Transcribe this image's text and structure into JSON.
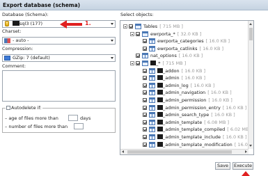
{
  "window": {
    "title": "Export database (schema)"
  },
  "left": {
    "database_label": "Database (Schema):",
    "database_value": "sql3 (177)",
    "charset_label": "Charset:",
    "charset_value": "- auto -",
    "compression_label": "Compression:",
    "compression_value": "GZip: 7 (default)",
    "comment_label": "Comment:",
    "autodelete": {
      "legend": "Autodelete if:",
      "age_label": "– age of files more than",
      "age_unit": "days",
      "number_label": "– number of files more than",
      "age_value": "",
      "number_value": ""
    }
  },
  "annotations": {
    "step1": "1.",
    "colors": {
      "annotation": "#e02020"
    }
  },
  "tree": {
    "label": "Select objects:",
    "rows": [
      {
        "name": "Tables",
        "size": "[ 715 MB ]",
        "icon": "folder-icon",
        "level": 0,
        "redacted": false
      },
      {
        "name": "ewrporta_*",
        "size": "[ 32.0 KB ]",
        "icon": "table-group-icon",
        "level": 1,
        "redacted": false
      },
      {
        "name": "ewrporta_categories",
        "size": "[ 16.0 KB ]",
        "icon": "table-icon",
        "level": 2,
        "redacted": false
      },
      {
        "name": "ewrporta_catlinks",
        "size": "[ 16.0 KB ]",
        "icon": "table-icon",
        "level": 2,
        "redacted": false
      },
      {
        "name": "nat_options",
        "size": "[ 16.0 KB ]",
        "icon": "table-icon",
        "level": 1,
        "redacted": false
      },
      {
        "name": "_*",
        "size": "[ 715 MB ]",
        "icon": "table-group-icon",
        "level": 1,
        "redacted": true
      },
      {
        "name": "_addon",
        "size": "[ 16.0 KB ]",
        "icon": "table-icon",
        "level": 2,
        "redacted": true
      },
      {
        "name": "_admin",
        "size": "[ 16.0 KB ]",
        "icon": "table-icon",
        "level": 2,
        "redacted": true
      },
      {
        "name": "_admin_log",
        "size": "[ 16.0 KB ]",
        "icon": "table-icon",
        "level": 2,
        "redacted": true
      },
      {
        "name": "_admin_navigation",
        "size": "[ 16.0 KB ]",
        "icon": "table-icon",
        "level": 2,
        "redacted": true
      },
      {
        "name": "_admin_permission",
        "size": "[ 16.0 KB ]",
        "icon": "table-icon",
        "level": 2,
        "redacted": true
      },
      {
        "name": "_admin_permission_entry",
        "size": "[ 16.0 KB ]",
        "icon": "table-icon",
        "level": 2,
        "redacted": true
      },
      {
        "name": "_admin_search_type",
        "size": "[ 16.0 KB ]",
        "icon": "table-icon",
        "level": 2,
        "redacted": true
      },
      {
        "name": "_admin_template",
        "size": "[ 6.08 MB ]",
        "icon": "table-icon",
        "level": 2,
        "redacted": true
      },
      {
        "name": "_admin_template_compiled",
        "size": "[ 6.02 MB ]",
        "icon": "table-icon",
        "level": 2,
        "redacted": true
      },
      {
        "name": "_admin_template_include",
        "size": "[ 16.0 KB ]",
        "icon": "table-icon",
        "level": 2,
        "redacted": true
      },
      {
        "name": "_admin_template_modification",
        "size": "[ 16.0 KB ]",
        "icon": "table-icon",
        "level": 2,
        "redacted": true
      }
    ]
  },
  "buttons": {
    "save": "Save",
    "execute": "Execute"
  }
}
